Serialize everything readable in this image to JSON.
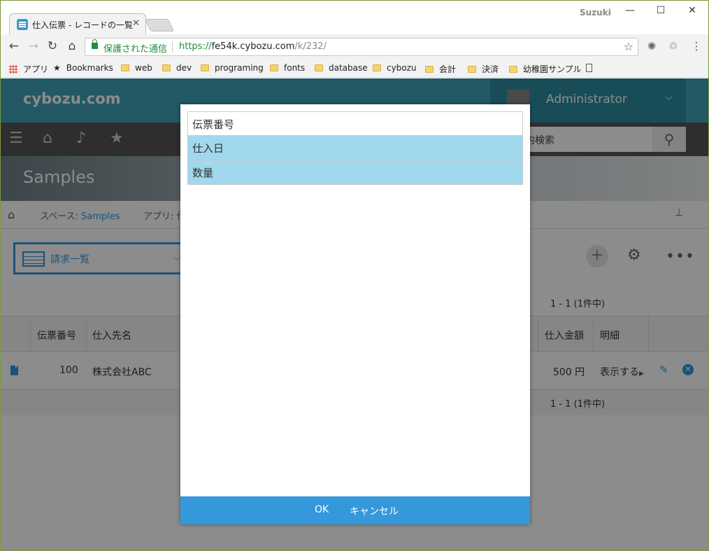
{
  "browser": {
    "tab_title": "仕入伝票 - レコードの一覧",
    "tab_close": "✕",
    "profile": "Suzuki",
    "window_controls": {
      "minimize": "—",
      "maximize": "☐",
      "close": "✕"
    },
    "nav": {
      "back": "←",
      "forward": "→",
      "reload": "↻",
      "home": "⌂"
    },
    "secure_label": "保護された通信",
    "url": {
      "scheme": "https://",
      "host": "fe54k.cybozu.com",
      "path": "/k/232/"
    },
    "star": "☆",
    "menu": "⋮",
    "bookmarks": [
      "アプリ",
      "Bookmarks",
      "web",
      "dev",
      "programing",
      "fonts",
      "database",
      "cybozu",
      "会計",
      "決済",
      "幼稚園サンプル"
    ]
  },
  "app": {
    "logo": "cybozu.com",
    "user": "Administrator",
    "search_placeholder": "内検索",
    "space_title": "Samples",
    "breadcrumb": {
      "space_prefix": "スペース: ",
      "space_link": "Samples",
      "app_prefix": "アプリ: 仕"
    },
    "view_name": "請求一覧",
    "pager": "1 - 1  (1件中)",
    "columns": {
      "no": "伝票番号",
      "supplier": "仕入先名",
      "amount": "仕入金額",
      "detail": "明細"
    },
    "row": {
      "no": "100",
      "supplier": "株式会社ABC",
      "amount": "500 円",
      "detail": "表示する"
    }
  },
  "dialog": {
    "items": [
      {
        "label": "伝票番号",
        "selected": false
      },
      {
        "label": "仕入日",
        "selected": true
      },
      {
        "label": "数量",
        "selected": true
      }
    ],
    "ok_label": "OK",
    "cancel_label": "キャンセル"
  }
}
